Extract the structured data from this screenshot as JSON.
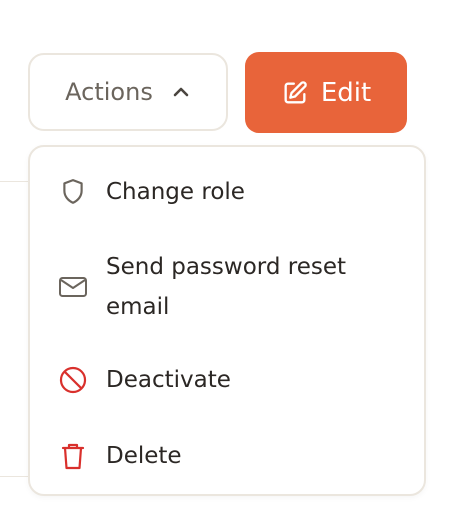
{
  "toolbar": {
    "actions_label": "Actions",
    "actions_icon": "chevron-up-icon",
    "edit_label": "Edit",
    "edit_icon": "edit-icon",
    "edit_color": "#e8643a"
  },
  "menu": {
    "items": [
      {
        "label": "Change role",
        "icon": "shield-icon",
        "color": "#2b2724"
      },
      {
        "label": "Send password reset email",
        "icon": "mail-icon",
        "color": "#2b2724"
      },
      {
        "label": "Deactivate",
        "icon": "ban-icon",
        "color": "#d9302c"
      },
      {
        "label": "Delete",
        "icon": "trash-icon",
        "color": "#d9302c"
      }
    ]
  }
}
